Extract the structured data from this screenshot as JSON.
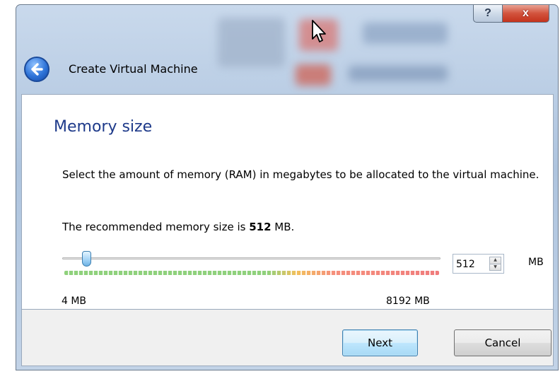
{
  "window": {
    "title": "Create Virtual Machine",
    "help_label": "?",
    "close_label": "x"
  },
  "page": {
    "title": "Memory size",
    "description": "Select the amount of memory (RAM) in megabytes to be allocated to the virtual machine.",
    "recommended_prefix": "The recommended memory size is ",
    "recommended_value": "512",
    "recommended_suffix": " MB."
  },
  "memory_slider": {
    "min_label": "4 MB",
    "max_label": "8192 MB",
    "value": 512,
    "min": 4,
    "max": 8192
  },
  "memory_spinbox": {
    "value": "512",
    "unit": "MB"
  },
  "buttons": {
    "next": "Next",
    "cancel": "Cancel"
  },
  "colors": {
    "title_blue": "#1e3a8a",
    "close_red": "#c4321c",
    "accent_blue": "#2f74d8"
  }
}
